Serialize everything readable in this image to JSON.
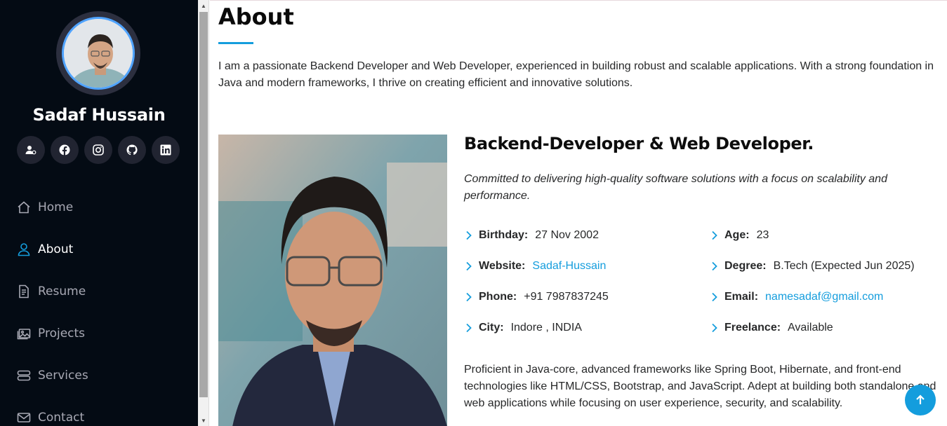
{
  "sidebar": {
    "name": "Sadaf Hussain",
    "socials": [
      {
        "icon": "user-card-icon"
      },
      {
        "icon": "facebook-icon"
      },
      {
        "icon": "instagram-icon"
      },
      {
        "icon": "github-icon"
      },
      {
        "icon": "linkedin-icon"
      }
    ],
    "nav": [
      {
        "label": "Home",
        "icon": "home-icon",
        "active": false
      },
      {
        "label": "About",
        "icon": "person-icon",
        "active": true
      },
      {
        "label": "Resume",
        "icon": "file-icon",
        "active": false
      },
      {
        "label": "Projects",
        "icon": "images-icon",
        "active": false
      },
      {
        "label": "Services",
        "icon": "server-icon",
        "active": false
      },
      {
        "label": "Contact",
        "icon": "envelope-icon",
        "active": false
      }
    ]
  },
  "about": {
    "title": "About",
    "intro": "I am a passionate Backend Developer and Web Developer, experienced in building robust and scalable applications. With a strong foundation in Java and modern frameworks, I thrive on creating efficient and innovative solutions.",
    "role": "Backend-Developer & Web Developer.",
    "tagline": "Committed to delivering high-quality software solutions with a focus on scalability and performance.",
    "details": [
      {
        "label": "Birthday:",
        "value": "27 Nov 2002",
        "link": false
      },
      {
        "label": "Age:",
        "value": "23",
        "link": false
      },
      {
        "label": "Website:",
        "value": "Sadaf-Hussain",
        "link": true
      },
      {
        "label": "Degree:",
        "value": "B.Tech (Expected Jun 2025)",
        "link": false
      },
      {
        "label": "Phone:",
        "value": "+91 7987837245",
        "link": false
      },
      {
        "label": "Email:",
        "value": "namesadaf@gmail.com",
        "link": true
      },
      {
        "label": "City:",
        "value": "Indore , INDIA",
        "link": false
      },
      {
        "label": "Freelance:",
        "value": "Available",
        "link": false
      }
    ],
    "bio": "Proficient in Java-core, advanced frameworks like Spring Boot, Hibernate, and front-end technologies like HTML/CSS, Bootstrap, and JavaScript. Adept at building both standalone and web applications while focusing on user experience, security, and scalability."
  },
  "colors": {
    "accent": "#149ddd",
    "sidebar_bg": "#040b14",
    "social_bg": "#212431"
  },
  "back_to_top": {
    "icon": "arrow-up-icon"
  }
}
